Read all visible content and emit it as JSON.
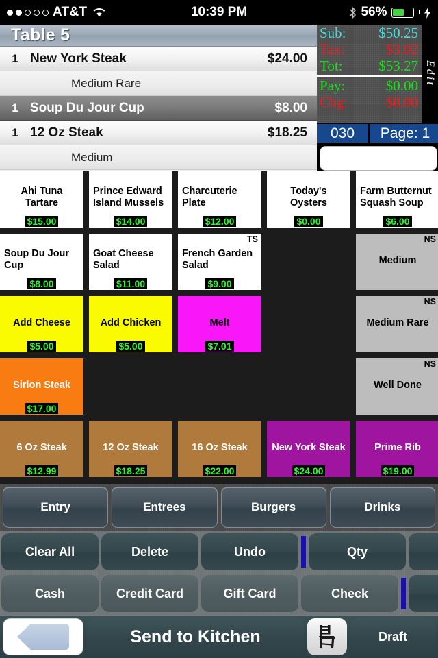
{
  "status_bar": {
    "signal_dots_filled": 2,
    "signal_dots_total": 5,
    "carrier": "AT&T",
    "wifi_icon": "wifi-icon",
    "time": "10:39 PM",
    "bluetooth_icon": "bluetooth-icon",
    "battery_percent": "56%",
    "charging_icon": "lightning-bolt-icon"
  },
  "order": {
    "table_title": "Table 5",
    "rows": [
      {
        "type": "item",
        "qty": "1",
        "name": "New York Steak",
        "price": "$24.00",
        "selected": false
      },
      {
        "type": "modifier",
        "name": "Medium Rare"
      },
      {
        "type": "item",
        "qty": "1",
        "name": "Soup Du Jour Cup",
        "price": "$8.00",
        "selected": true
      },
      {
        "type": "item",
        "qty": "1",
        "name": "12 Oz Steak",
        "price": "$18.25",
        "selected": false
      },
      {
        "type": "modifier",
        "name": "Medium"
      }
    ]
  },
  "totals": {
    "sub_label": "Sub:",
    "sub_value": "$50.25",
    "sub_color": "#4ad9d9",
    "tax_label": "Tax:",
    "tax_value": "$3.02",
    "tax_color": "#f41717",
    "tot_label": "Tot:",
    "tot_value": "$53.27",
    "tot_color": "#17e017",
    "pay_label": "Pay:",
    "pay_value": "$0.00",
    "pay_color": "#17e017",
    "chg_label": "Chg:",
    "chg_value": "$0.00",
    "chg_color": "#f41717",
    "edit_label": "Edit",
    "order_number": "030",
    "page_label": "Page: 1",
    "text_field_value": ""
  },
  "menu": {
    "tiles": [
      {
        "name": "Ahi Tuna Tartare",
        "price": "$15.00",
        "style": "white",
        "badge": "",
        "col": 0,
        "row": 0,
        "align": "center"
      },
      {
        "name": "Prince Edward Island Mussels",
        "price": "$14.00",
        "style": "white",
        "badge": "",
        "col": 1,
        "row": 0,
        "align": "left"
      },
      {
        "name": "Charcuterie Plate",
        "price": "$12.00",
        "style": "white",
        "badge": "",
        "col": 2,
        "row": 0,
        "align": "left"
      },
      {
        "name": "Today's Oysters",
        "price": "$0.00",
        "style": "white",
        "badge": "",
        "col": 3,
        "row": 0,
        "align": "center"
      },
      {
        "name": "Farm Butternut Squash Soup",
        "price": "$6.00",
        "style": "white",
        "badge": "",
        "col": 4,
        "row": 0,
        "align": "left"
      },
      {
        "name": "Soup Du Jour Cup",
        "price": "$8.00",
        "style": "white",
        "badge": "",
        "col": 0,
        "row": 1,
        "align": "left"
      },
      {
        "name": "Goat Cheese Salad",
        "price": "$11.00",
        "style": "white",
        "badge": "",
        "col": 1,
        "row": 1,
        "align": "left"
      },
      {
        "name": "French Garden Salad",
        "price": "$9.00",
        "style": "white",
        "badge": "TS",
        "col": 2,
        "row": 1,
        "align": "left"
      },
      {
        "name": "Medium",
        "price": "",
        "style": "gray",
        "badge": "NS",
        "col": 4,
        "row": 1,
        "align": "center"
      },
      {
        "name": "Add Cheese",
        "price": "$5.00",
        "style": "yellow",
        "badge": "",
        "col": 0,
        "row": 2,
        "align": "center"
      },
      {
        "name": "Add Chicken",
        "price": "$5.00",
        "style": "yellow",
        "badge": "",
        "col": 1,
        "row": 2,
        "align": "center"
      },
      {
        "name": "Melt",
        "price": "$7.01",
        "style": "magenta",
        "badge": "",
        "col": 2,
        "row": 2,
        "align": "center"
      },
      {
        "name": "Medium Rare",
        "price": "",
        "style": "gray",
        "badge": "NS",
        "col": 4,
        "row": 2,
        "align": "center"
      },
      {
        "name": "Sirlon Steak",
        "price": "$17.00",
        "style": "orange",
        "badge": "",
        "col": 0,
        "row": 3,
        "align": "center"
      },
      {
        "name": "Well Done",
        "price": "",
        "style": "gray",
        "badge": "NS",
        "col": 4,
        "row": 3,
        "align": "center"
      },
      {
        "name": "6 Oz Steak",
        "price": "$12.99",
        "style": "brown",
        "badge": "",
        "col": 0,
        "row": 4,
        "align": "center"
      },
      {
        "name": "12 Oz Steak",
        "price": "$18.25",
        "style": "brown",
        "badge": "",
        "col": 1,
        "row": 4,
        "align": "center"
      },
      {
        "name": "16 Oz Steak",
        "price": "$22.00",
        "style": "brown",
        "badge": "",
        "col": 2,
        "row": 4,
        "align": "center"
      },
      {
        "name": "New York Steak",
        "price": "$24.00",
        "style": "purple",
        "badge": "",
        "col": 3,
        "row": 4,
        "align": "center"
      },
      {
        "name": "Prime Rib",
        "price": "$19.00",
        "style": "purple",
        "badge": "",
        "col": 4,
        "row": 4,
        "align": "center"
      }
    ]
  },
  "categories": [
    {
      "label": "Entry"
    },
    {
      "label": "Entrees"
    },
    {
      "label": "Burgers"
    },
    {
      "label": "Drinks"
    }
  ],
  "actions_row1": [
    {
      "label": "Clear All",
      "dim": false
    },
    {
      "label": "Delete",
      "dim": false
    },
    {
      "label": "Undo",
      "dim": false
    },
    {
      "label": "Qty",
      "dim": false
    },
    {
      "label": "",
      "dim": false
    }
  ],
  "actions_row2": [
    {
      "label": "Cash",
      "dim": true
    },
    {
      "label": "Credit Card",
      "dim": true
    },
    {
      "label": "Gift Card",
      "dim": true
    },
    {
      "label": "Check",
      "dim": true
    },
    {
      "label": "",
      "dim": false
    }
  ],
  "bottom_bar": {
    "back_icon": "back-arrow-icon",
    "send_label": "Send to Kitchen",
    "chair_icon": "chair-icon",
    "draft_label": "Draft"
  }
}
